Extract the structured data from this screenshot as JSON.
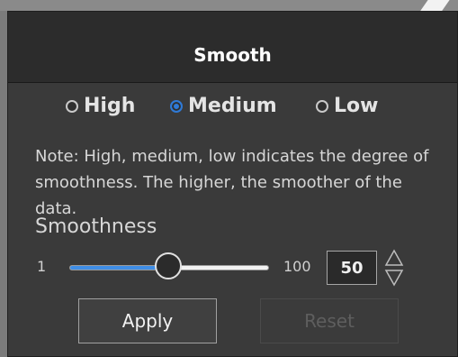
{
  "dialog": {
    "title": "Smooth",
    "modes": [
      {
        "label": "High",
        "checked": false
      },
      {
        "label": "Medium",
        "checked": true
      },
      {
        "label": "Low",
        "checked": false
      }
    ],
    "note": "Note: High, medium, low indicates the degree of smoothness. The higher, the smoother of the data.",
    "smoothness_label": "Smoothness",
    "slider": {
      "min_label": "1",
      "max_label": "100",
      "value": "50",
      "min": 1,
      "max": 100,
      "current": 50
    },
    "apply_label": "Apply",
    "reset_label": "Reset"
  },
  "colors": {
    "accent": "#3f8ee6",
    "panel": "#3a3a3a",
    "header": "#2c2c2c"
  },
  "icons": [
    "radio-unchecked-icon",
    "radio-checked-icon",
    "stepper-up-icon",
    "stepper-down-icon"
  ]
}
